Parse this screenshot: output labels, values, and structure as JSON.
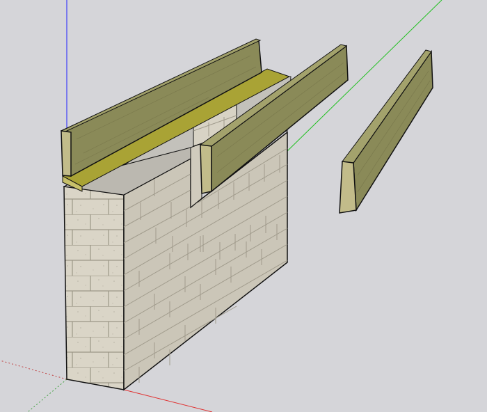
{
  "app": {
    "kind": "3d-modeling-viewport",
    "background_color": "#d5d5d9"
  },
  "axes": {
    "blue_color": "#2020ff",
    "red_color": "#e03030",
    "green_color": "#20c020"
  },
  "model": {
    "wall_material": "concrete-block",
    "wall_light_color": "#d9d4c6",
    "wall_dark_color": "#c6c1b3",
    "mortar_color": "#9c9787",
    "timber_color": "#8a8a58",
    "timber_end_color": "#bfb98a",
    "plate_color": "#a6a02a",
    "slab_color": "#c4c2bc",
    "edge_color": "#111111"
  }
}
